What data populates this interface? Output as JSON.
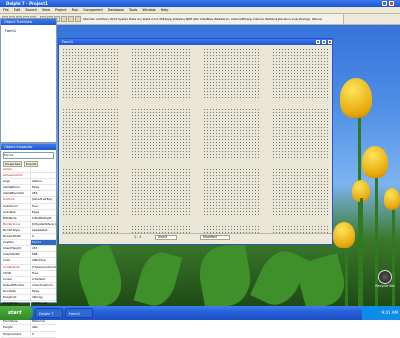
{
  "app": {
    "title": "Delphi 7 - Project1",
    "menus": [
      "File",
      "Edit",
      "Search",
      "View",
      "Project",
      "Run",
      "Component",
      "Database",
      "Tools",
      "Window",
      "Help"
    ],
    "toolbar_combo": "(None)",
    "palette_tabs": [
      "Standard",
      "Additional",
      "Win32",
      "System",
      "Data Access",
      "Data Controls",
      "dbExpress",
      "DataSnap",
      "BDE",
      "ADO",
      "InterBase",
      "WebServices",
      "InternetExpress",
      "Internet",
      "WebSnap",
      "Decision Cube",
      "Dialogs"
    ]
  },
  "tree_view": {
    "title": "Object TreeView",
    "root": "Form1"
  },
  "object_inspector": {
    "title": "Object Inspector",
    "selected_object": "Form1",
    "tabs": [
      "Properties",
      "Events"
    ],
    "properties": [
      {
        "name": "Action",
        "value": "",
        "red": true
      },
      {
        "name": "ActiveControl",
        "value": "",
        "red": true
      },
      {
        "name": "Align",
        "value": "alNone"
      },
      {
        "name": "AlphaBlend",
        "value": "False"
      },
      {
        "name": "AlphaBlendVal",
        "value": "255"
      },
      {
        "name": "Anchors",
        "value": "[akLeft,akTop]",
        "red": true
      },
      {
        "name": "AutoScroll",
        "value": "True"
      },
      {
        "name": "AutoSize",
        "value": "False"
      },
      {
        "name": "BiDiMode",
        "value": "bdLeftToRight"
      },
      {
        "name": "BorderIcons",
        "value": "[biSystemMenu]",
        "red": true
      },
      {
        "name": "BorderStyle",
        "value": "bsSizeable"
      },
      {
        "name": "BorderWidth",
        "value": "0"
      },
      {
        "name": "Caption",
        "value": "Form1",
        "highlight": true
      },
      {
        "name": "ClientHeight",
        "value": "453"
      },
      {
        "name": "ClientWidth",
        "value": "688"
      },
      {
        "name": "Color",
        "value": "clBtnFace"
      },
      {
        "name": "Constraints",
        "value": "(TSizeConstraints)",
        "red": true
      },
      {
        "name": "Ctl3D",
        "value": "True"
      },
      {
        "name": "Cursor",
        "value": "crDefault"
      },
      {
        "name": "DefaultMonitor",
        "value": "dmActiveForm"
      },
      {
        "name": "DockSite",
        "value": "False"
      },
      {
        "name": "DragKind",
        "value": "dkDrag"
      },
      {
        "name": "DragMode",
        "value": "dmManual"
      },
      {
        "name": "Enabled",
        "value": "True"
      },
      {
        "name": "Font",
        "value": "(TFont)",
        "red": true
      },
      {
        "name": "FormStyle",
        "value": "fsNormal"
      },
      {
        "name": "Height",
        "value": "480"
      },
      {
        "name": "HelpContext",
        "value": "0"
      }
    ]
  },
  "form_designer": {
    "title": "Form1"
  },
  "statusbar": {
    "position": "1 : 1",
    "mode": "Insert",
    "state": "Modified"
  },
  "taskbar": {
    "start_label": "start",
    "tasks": [
      "Delphi 7",
      "Form1"
    ],
    "clock": "9:41 AM"
  },
  "desktop": {
    "icon_label": "Recycle Bin"
  },
  "colors": {
    "titlebar": "#1d55d6",
    "chrome": "#ece9d8",
    "taskbar": "#2560d8",
    "start": "#2f8a24"
  }
}
